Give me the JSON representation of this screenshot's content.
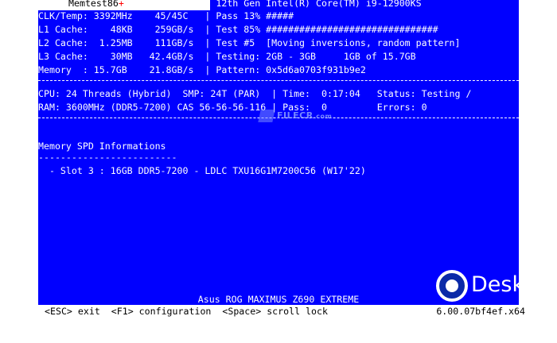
{
  "title": {
    "name": "Memtest86",
    "plus": "+"
  },
  "header_lines": [
    "                              | 12th Gen Intel(R) Core(TM) i9-12900KS",
    "CLK/Temp: 3392MHz    45/45C   | Pass 13% #####",
    "L1 Cache:    48KB    259GB/s  | Test 85% ###############################",
    "L2 Cache:  1.25MB    111GB/s  | Test #5  [Moving inversions, random pattern]",
    "L3 Cache:    30MB   42.4GB/s  | Testing: 2GB - 3GB     1GB of 15.7GB",
    "Memory  : 15.7GB    21.8GB/s  | Pattern: 0x5d6a0703f931b9e2"
  ],
  "status_lines": [
    "CPU: 24 Threads (Hybrid)  SMP: 24T (PAR)  | Time:  0:17:04   Status: Testing /",
    "RAM: 3600MHz (DDR5-7200) CAS 56-56-56-116 | Pass:  0         Errors: 0"
  ],
  "spd": {
    "heading": "Memory SPD Informations",
    "underline": "-------------------------",
    "slots": [
      "  - Slot 3 : 16GB DDR5-7200 - LDLC TXU16G1M7200C56 (W17'22)"
    ]
  },
  "board": "Asus ROG MAXIMUS Z690 EXTREME",
  "bottom_bar": {
    "keys": "<ESC> exit  <F1> configuration  <Space> scroll lock",
    "version": "6.00.07bf4ef.x64"
  },
  "watermarks": {
    "filecr": "FILECR",
    "filecr_sub": ".com",
    "brand": "DeskTop"
  },
  "colors": {
    "screen_bg": "#0000ff",
    "text": "#ffffff",
    "bar_bg": "#ffffff",
    "bar_text": "#000000",
    "title_plus": "#ff0000"
  }
}
